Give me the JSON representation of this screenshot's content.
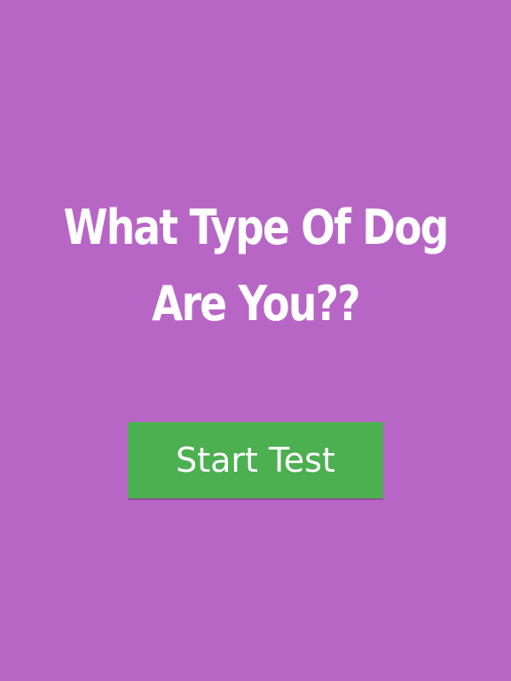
{
  "screen": {
    "background_color": "#b866c6"
  },
  "title": {
    "line1": "What Type Of Dog",
    "line2": "Are You??",
    "color": "#ffffff"
  },
  "start_button": {
    "label": "Start Test",
    "background_color": "#4caf50",
    "text_color": "#ffffff"
  }
}
